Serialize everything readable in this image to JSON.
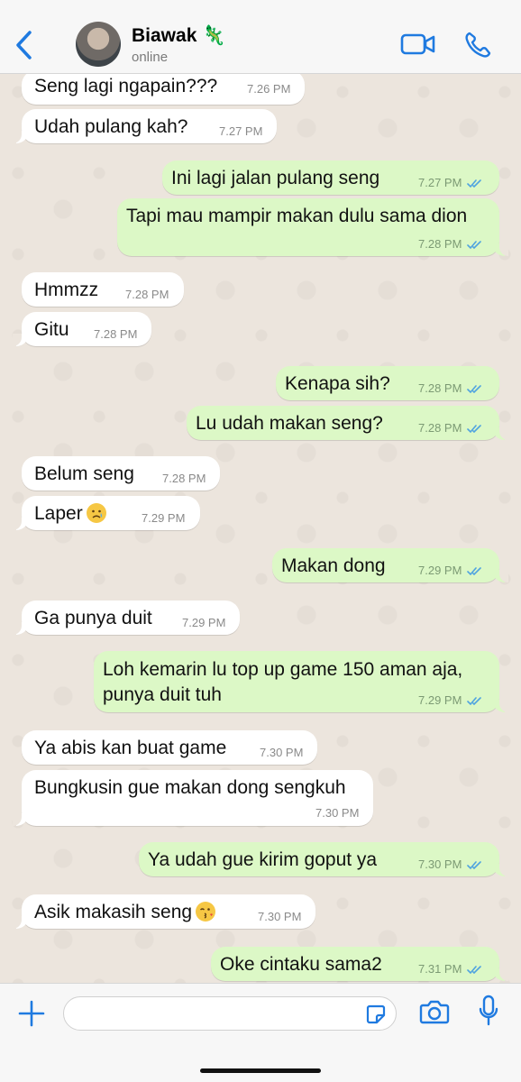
{
  "header": {
    "contact_name": "Biawak",
    "contact_emoji": "🦎",
    "status": "online",
    "icons": [
      "back-chevron-icon",
      "video-call-icon",
      "voice-call-icon"
    ]
  },
  "theme": {
    "accent": "#1f7ae0",
    "incoming_bubble": "#ffffff",
    "outgoing_bubble": "#dcf8c6",
    "read_ticks": "#4fa3e0"
  },
  "messages": [
    {
      "dir": "in",
      "text": "Seng lagi ngapain???",
      "time": "7.26 PM"
    },
    {
      "dir": "in",
      "text": "Udah pulang kah?",
      "time": "7.27 PM"
    },
    {
      "dir": "out",
      "text": "Ini lagi jalan pulang seng",
      "time": "7.27 PM"
    },
    {
      "dir": "out",
      "text": "Tapi mau mampir makan dulu sama dion",
      "time": "7.28 PM"
    },
    {
      "dir": "in",
      "text": "Hmmzz",
      "time": "7.28 PM"
    },
    {
      "dir": "in",
      "text": "Gitu",
      "time": "7.28 PM"
    },
    {
      "dir": "out",
      "text": "Kenapa sih?",
      "time": "7.28 PM"
    },
    {
      "dir": "out",
      "text": "Lu udah makan seng?",
      "time": "7.28 PM"
    },
    {
      "dir": "in",
      "text": "Belum seng",
      "time": "7.28 PM"
    },
    {
      "dir": "in",
      "text": "Laper",
      "emoji": "sad-face-emoji",
      "time": "7.29 PM"
    },
    {
      "dir": "out",
      "text": "Makan dong",
      "time": "7.29 PM"
    },
    {
      "dir": "in",
      "text": "Ga punya duit",
      "time": "7.29 PM"
    },
    {
      "dir": "out",
      "text_line1": "Loh kemarin lu top up game 150 aman aja,",
      "text_line2": "punya duit tuh",
      "time": "7.29 PM"
    },
    {
      "dir": "in",
      "text": "Ya abis kan buat game",
      "time": "7.30 PM"
    },
    {
      "dir": "in",
      "text": "Bungkusin gue makan dong sengkuh",
      "time": "7.30 PM"
    },
    {
      "dir": "out",
      "text": "Ya udah gue kirim goput ya",
      "time": "7.30 PM"
    },
    {
      "dir": "in",
      "text": "Asik makasih seng",
      "emoji": "kissing-face-emoji",
      "time": "7.30 PM"
    },
    {
      "dir": "out",
      "text": "Oke cintaku sama2",
      "time": "7.31 PM"
    }
  ],
  "composer": {
    "placeholder": "",
    "icons": [
      "plus-icon",
      "sticker-icon",
      "camera-icon",
      "microphone-icon"
    ]
  }
}
